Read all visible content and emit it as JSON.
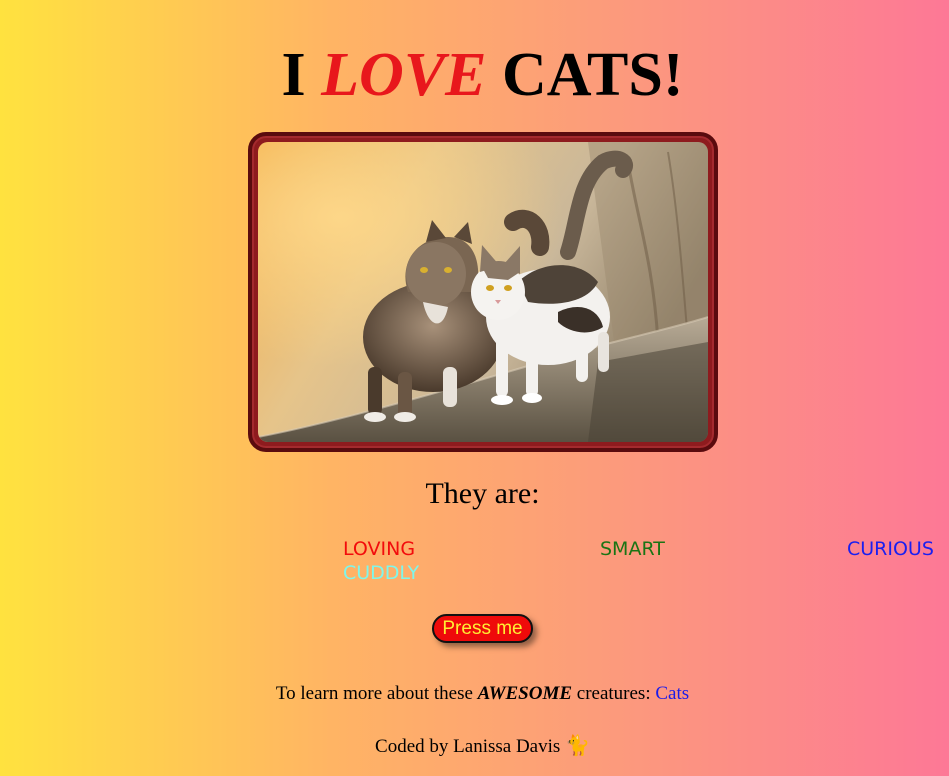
{
  "header": {
    "title_prefix": "I",
    "title_emphasis": "LOVE",
    "title_suffix": "CATS!"
  },
  "photo": {
    "icon": "two-cats-photo"
  },
  "traits": {
    "heading": "They are:",
    "items": [
      "LOVING",
      "SMART",
      "CURIOUS",
      "CUDDLY"
    ],
    "colors": [
      "#f20c0c",
      "#1a7414",
      "#1a1ff0",
      "#7ff6ea"
    ]
  },
  "button": {
    "label": "Press me",
    "background": "#ef0a0a",
    "text_color": "#ffee33"
  },
  "learn_more": {
    "text_before": "To learn more about these",
    "emphasis": "AWESOME",
    "text_after": "creatures:",
    "link_label": "Cats"
  },
  "footer": {
    "credit": "Coded by Lanissa Davis",
    "icon": "🐈",
    "icon_name": "cat-icon"
  },
  "colors": {
    "gradient_left": "#ffe23f",
    "gradient_right": "#fd7896",
    "accent_red": "#e8171c",
    "link_blue": "#1b1bea"
  }
}
